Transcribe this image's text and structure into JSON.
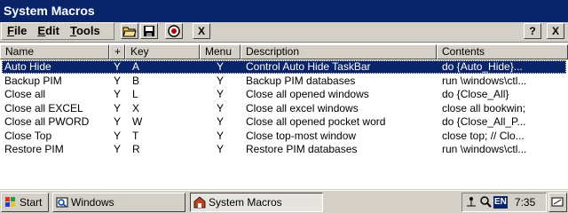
{
  "window": {
    "title": "System Macros"
  },
  "menu": [
    {
      "underline": "F",
      "rest": "ile"
    },
    {
      "underline": "E",
      "rest": "dit"
    },
    {
      "underline": "T",
      "rest": "ools"
    }
  ],
  "toolbar": {
    "help_label": "?",
    "close_label": "X",
    "delete_label": "X"
  },
  "columns": [
    "Name",
    "+",
    "Key",
    "Menu",
    "Description",
    "Contents"
  ],
  "rows": [
    {
      "name": "Auto Hide",
      "plus": "Y",
      "key": "A",
      "menu": "Y",
      "description": "Control Auto Hide TaskBar",
      "contents": "do {Auto_Hide}..."
    },
    {
      "name": "Backup PIM",
      "plus": "Y",
      "key": "B",
      "menu": "Y",
      "description": "Backup PIM databases",
      "contents": "run \\windows\\ctl..."
    },
    {
      "name": "Close all",
      "plus": "Y",
      "key": "L",
      "menu": "Y",
      "description": "Close all opened windows",
      "contents": "do {Close_All}"
    },
    {
      "name": "Close all EXCEL",
      "plus": "Y",
      "key": "X",
      "menu": "Y",
      "description": "Close all excel windows",
      "contents": "close all bookwin;"
    },
    {
      "name": "Close all PWORD",
      "plus": "Y",
      "key": "W",
      "menu": "Y",
      "description": "Close all opened pocket word",
      "contents": "do {Close_All_P..."
    },
    {
      "name": "Close Top",
      "plus": "Y",
      "key": "T",
      "menu": "Y",
      "description": "Close top-most window",
      "contents": "close top;  // Clo..."
    },
    {
      "name": "Restore PIM",
      "plus": "Y",
      "key": "R",
      "menu": "Y",
      "description": "Restore PIM databases",
      "contents": "run \\windows\\ctl..."
    }
  ],
  "selected_row": 0,
  "taskbar": {
    "start_label": "Start",
    "tasks": [
      "Windows",
      "System Macros"
    ],
    "active_task": 1,
    "input_indicator": "EN",
    "clock": "7:35"
  }
}
